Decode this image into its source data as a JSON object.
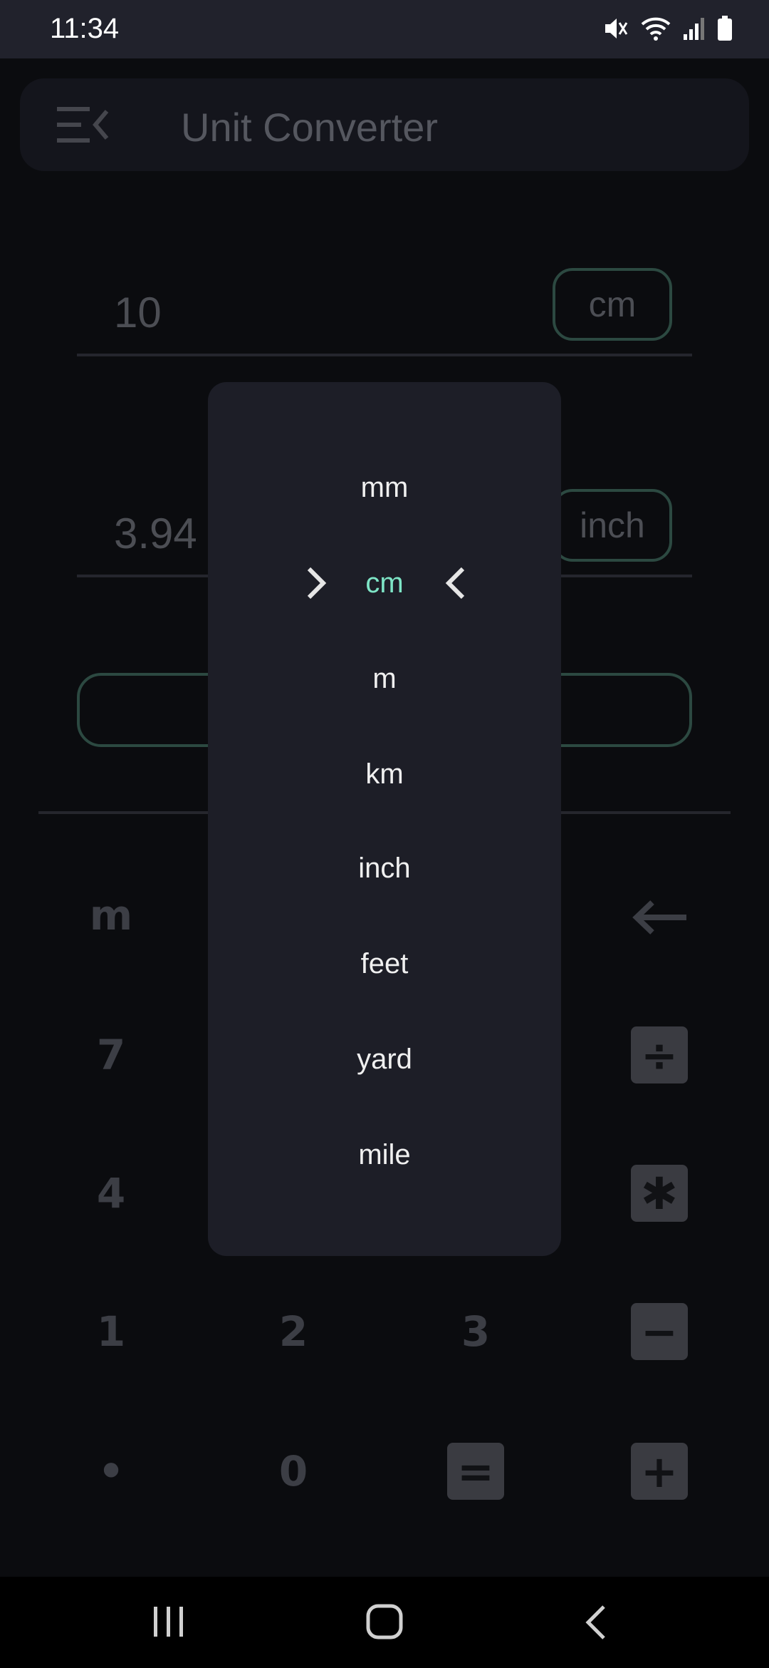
{
  "status_bar": {
    "time": "11:34"
  },
  "app": {
    "title": "Unit Converter",
    "from": {
      "value": "10",
      "unit": "cm"
    },
    "to": {
      "value": "3.94",
      "unit": "inch"
    }
  },
  "keypad": {
    "memory": "m",
    "row1": [
      "7"
    ],
    "row2": [
      "4"
    ],
    "row3": [
      "1",
      "2",
      "3"
    ],
    "row4": [
      "•",
      "0"
    ],
    "ops": {
      "divide": "÷",
      "multiply": "✱",
      "minus": "−",
      "plus": "+",
      "equals": "="
    }
  },
  "unit_picker": {
    "options": [
      "mm",
      "cm",
      "m",
      "km",
      "inch",
      "feet",
      "yard",
      "mile"
    ],
    "selected": "cm",
    "selected_color": "#7ee5c6"
  },
  "colors": {
    "accent": "#7ee5c6",
    "chip_border": "#2c4941",
    "panel": "#1d1e27"
  }
}
